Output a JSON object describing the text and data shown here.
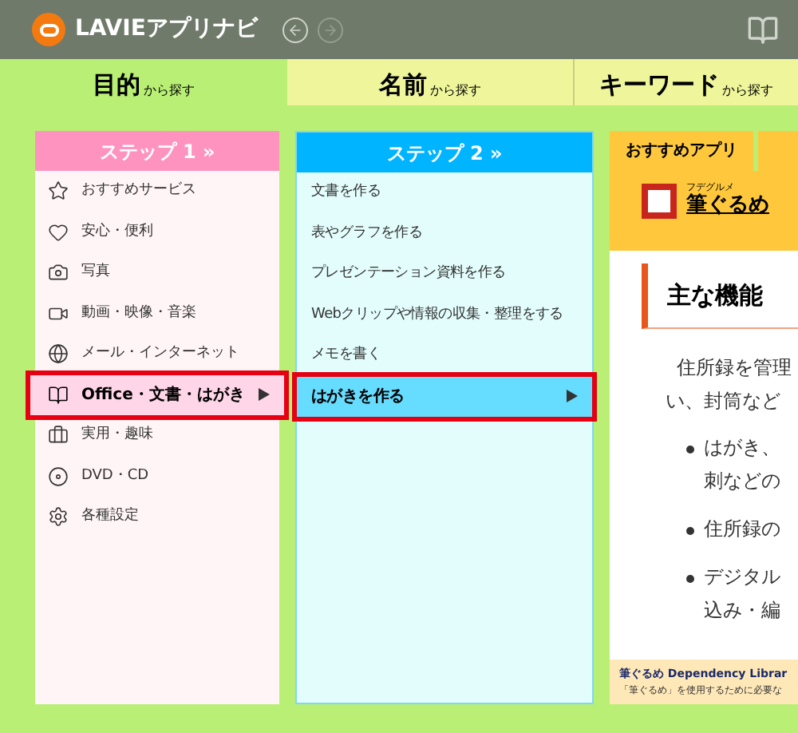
{
  "app": {
    "title": "LAVIEアプリナビ"
  },
  "tabs": [
    {
      "main": "目的",
      "sub": "から探す",
      "selected": true
    },
    {
      "main": "名前",
      "sub": "から探す",
      "selected": false
    },
    {
      "main": "キーワード",
      "sub": "から探す",
      "selected": false
    }
  ],
  "step1": {
    "title": "ステップ 1 »",
    "items": [
      {
        "label": "おすすめサービス",
        "selected": false
      },
      {
        "label": "安心・便利",
        "selected": false
      },
      {
        "label": "写真",
        "selected": false
      },
      {
        "label": "動画・映像・音楽",
        "selected": false
      },
      {
        "label": "メール・インターネット",
        "selected": false
      },
      {
        "label": "Office・文書・はがき",
        "selected": true
      },
      {
        "label": "実用・趣味",
        "selected": false
      },
      {
        "label": "DVD・CD",
        "selected": false
      },
      {
        "label": "各種設定",
        "selected": false
      }
    ]
  },
  "step2": {
    "title": "ステップ 2 »",
    "items": [
      {
        "label": "文書を作る",
        "selected": false
      },
      {
        "label": "表やグラフを作る",
        "selected": false
      },
      {
        "label": "プレゼンテーション資料を作る",
        "selected": false
      },
      {
        "label": "Webクリップや情報の収集・整理をする",
        "selected": false
      },
      {
        "label": "メモを書く",
        "selected": false
      },
      {
        "label": "はがきを作る",
        "selected": true
      }
    ]
  },
  "recommend": {
    "tab": "おすすめアプリ",
    "ruby": "フデグルメ",
    "app_name": "筆ぐるめ",
    "heading": "主な機能",
    "intro": [
      "住所録を管理",
      "い、封筒など"
    ],
    "bullets": [
      [
        "はがき、",
        "刺などの"
      ],
      [
        "住所録の"
      ],
      [
        "デジタル",
        "込み・編"
      ]
    ],
    "footer_title": "筆ぐるめ Dependency Librar",
    "footer_text": "「筆ぐるめ」を使用するために必要な"
  }
}
